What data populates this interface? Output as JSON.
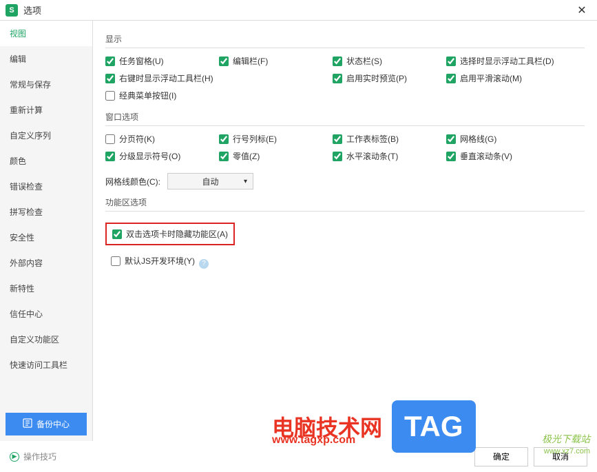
{
  "window": {
    "icon_letter": "S",
    "title": "选项"
  },
  "sidebar": {
    "items": [
      "视图",
      "编辑",
      "常规与保存",
      "重新计算",
      "自定义序列",
      "颜色",
      "错误检查",
      "拼写检查",
      "安全性",
      "外部内容",
      "新特性",
      "信任中心",
      "自定义功能区",
      "快速访问工具栏"
    ],
    "active_index": 0,
    "backup_label": "备份中心"
  },
  "sections": {
    "display": {
      "title": "显示",
      "items": [
        {
          "label": "任务窗格(U)",
          "checked": true
        },
        {
          "label": "编辑栏(F)",
          "checked": true
        },
        {
          "label": "状态栏(S)",
          "checked": true
        },
        {
          "label": "选择时显示浮动工具栏(D)",
          "checked": true
        },
        {
          "label": "右键时显示浮动工具栏(H)",
          "checked": true
        },
        {
          "label": "",
          "checked": false,
          "empty": true
        },
        {
          "label": "启用实时预览(P)",
          "checked": true
        },
        {
          "label": "启用平滑滚动(M)",
          "checked": true
        },
        {
          "label": "经典菜单按钮(I)",
          "checked": false
        }
      ]
    },
    "windowOptions": {
      "title": "窗口选项",
      "items": [
        {
          "label": "分页符(K)",
          "checked": false
        },
        {
          "label": "行号列标(E)",
          "checked": true
        },
        {
          "label": "工作表标签(B)",
          "checked": true
        },
        {
          "label": "网格线(G)",
          "checked": true
        },
        {
          "label": "分级显示符号(O)",
          "checked": true
        },
        {
          "label": "零值(Z)",
          "checked": true
        },
        {
          "label": "水平滚动条(T)",
          "checked": true
        },
        {
          "label": "垂直滚动条(V)",
          "checked": true
        }
      ],
      "gridline_color_label": "网格线颜色(C):",
      "gridline_color_value": "自动"
    },
    "ribbonOptions": {
      "title": "功能区选项",
      "hide_ribbon": {
        "label": "双击选项卡时隐藏功能区(A)",
        "checked": true
      },
      "js_dev": {
        "label": "默认JS开发环境(Y)",
        "checked": false
      }
    }
  },
  "footer": {
    "tip_label": "操作技巧",
    "ok_label": "确定",
    "cancel_label": "取消"
  },
  "watermark": {
    "text1": "电脑技术网",
    "tag": "TAG",
    "url1": "www.tagxp.com",
    "text2": "极光下载站",
    "url2": "www.xz7.com"
  }
}
